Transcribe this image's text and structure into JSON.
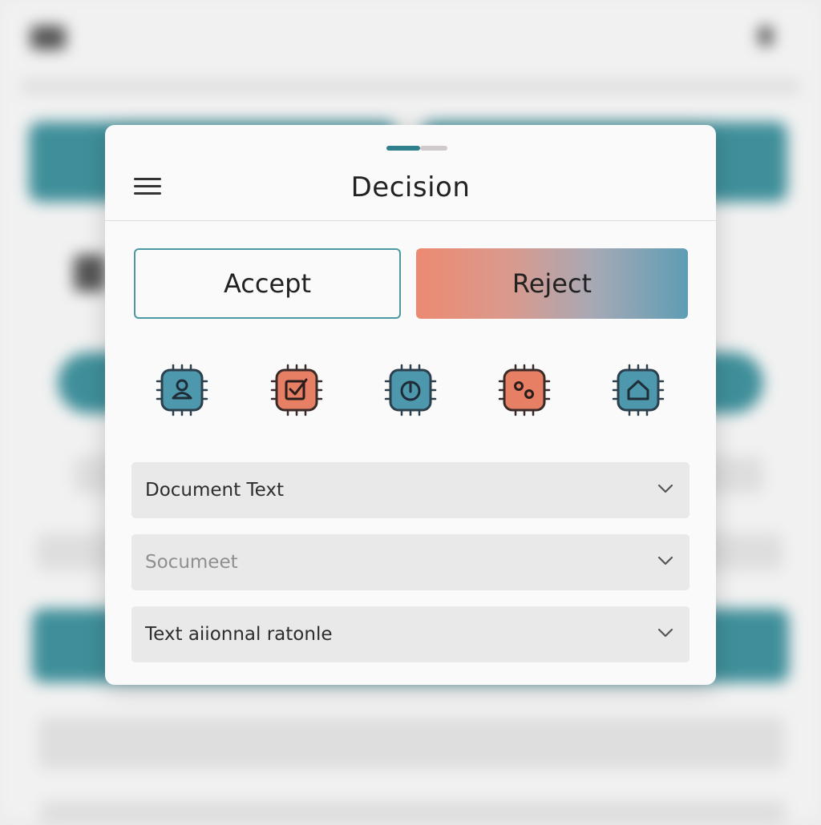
{
  "modal": {
    "title": "Decision",
    "accept_label": "Accept",
    "reject_label": "Reject"
  },
  "icons": [
    {
      "name": "person-chip-icon",
      "color": "#4e98ae"
    },
    {
      "name": "checkbox-chip-icon",
      "color": "#e77f64"
    },
    {
      "name": "power-chip-icon",
      "color": "#4e98ae"
    },
    {
      "name": "dots-chip-icon",
      "color": "#e77f64"
    },
    {
      "name": "home-chip-icon",
      "color": "#4e98ae"
    }
  ],
  "dropdowns": [
    {
      "value": "Document Text"
    },
    {
      "placeholder": "Socumeet"
    },
    {
      "value": "Text aiionnal ratonle"
    }
  ],
  "colors": {
    "accent_teal": "#3f8f9a",
    "accent_coral": "#e77f64",
    "modal_bg": "#fafafa"
  }
}
